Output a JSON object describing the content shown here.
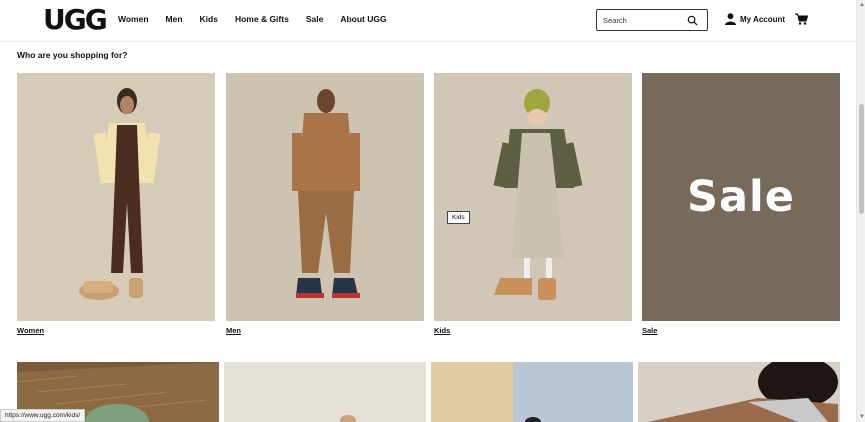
{
  "header": {
    "logo": "UGG",
    "nav": [
      "Women",
      "Men",
      "Kids",
      "Home & Gifts",
      "Sale",
      "About UGG"
    ],
    "search_placeholder": "Search",
    "account_label": "My Account"
  },
  "section": {
    "title": "Who are you shopping for?"
  },
  "cards": [
    {
      "label": "Women"
    },
    {
      "label": "Men"
    },
    {
      "label": "Kids"
    },
    {
      "label": "Sale",
      "overlay_text": "Sale"
    }
  ],
  "tooltip": "Kids",
  "status_url": "https://www.ugg.com/kids/",
  "colors": {
    "sale_bg": "#786a5a",
    "photo_bg": "#d8cdbc"
  }
}
